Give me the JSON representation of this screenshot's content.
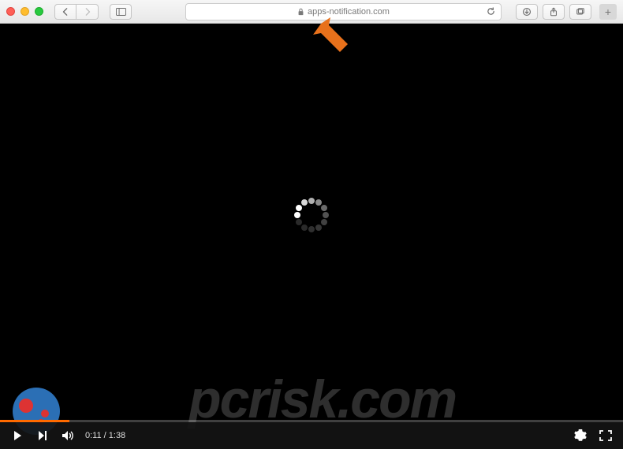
{
  "chrome": {
    "url": "apps-notification.com"
  },
  "arrow": {
    "color": "#e8711b"
  },
  "spinner": {
    "dots": [
      {
        "angle": 270,
        "color": "#ffffff"
      },
      {
        "angle": 300,
        "color": "#ffffff"
      },
      {
        "angle": 330,
        "color": "#d8d8d8"
      },
      {
        "angle": 0,
        "color": "#b0b0b0"
      },
      {
        "angle": 30,
        "color": "#8a8a8a"
      },
      {
        "angle": 60,
        "color": "#6a6a6a"
      },
      {
        "angle": 90,
        "color": "#525252"
      },
      {
        "angle": 120,
        "color": "#414141"
      },
      {
        "angle": 150,
        "color": "#363636"
      },
      {
        "angle": 180,
        "color": "#2f2f2f"
      },
      {
        "angle": 210,
        "color": "#2a2a2a"
      },
      {
        "angle": 240,
        "color": "#2a2a2a"
      }
    ]
  },
  "watermark": {
    "text": "pcrisk.com"
  },
  "video": {
    "current_time": "0:11",
    "separator": " / ",
    "duration": "1:38",
    "progress_percent": 11.2,
    "accent": "#ff6a00"
  }
}
